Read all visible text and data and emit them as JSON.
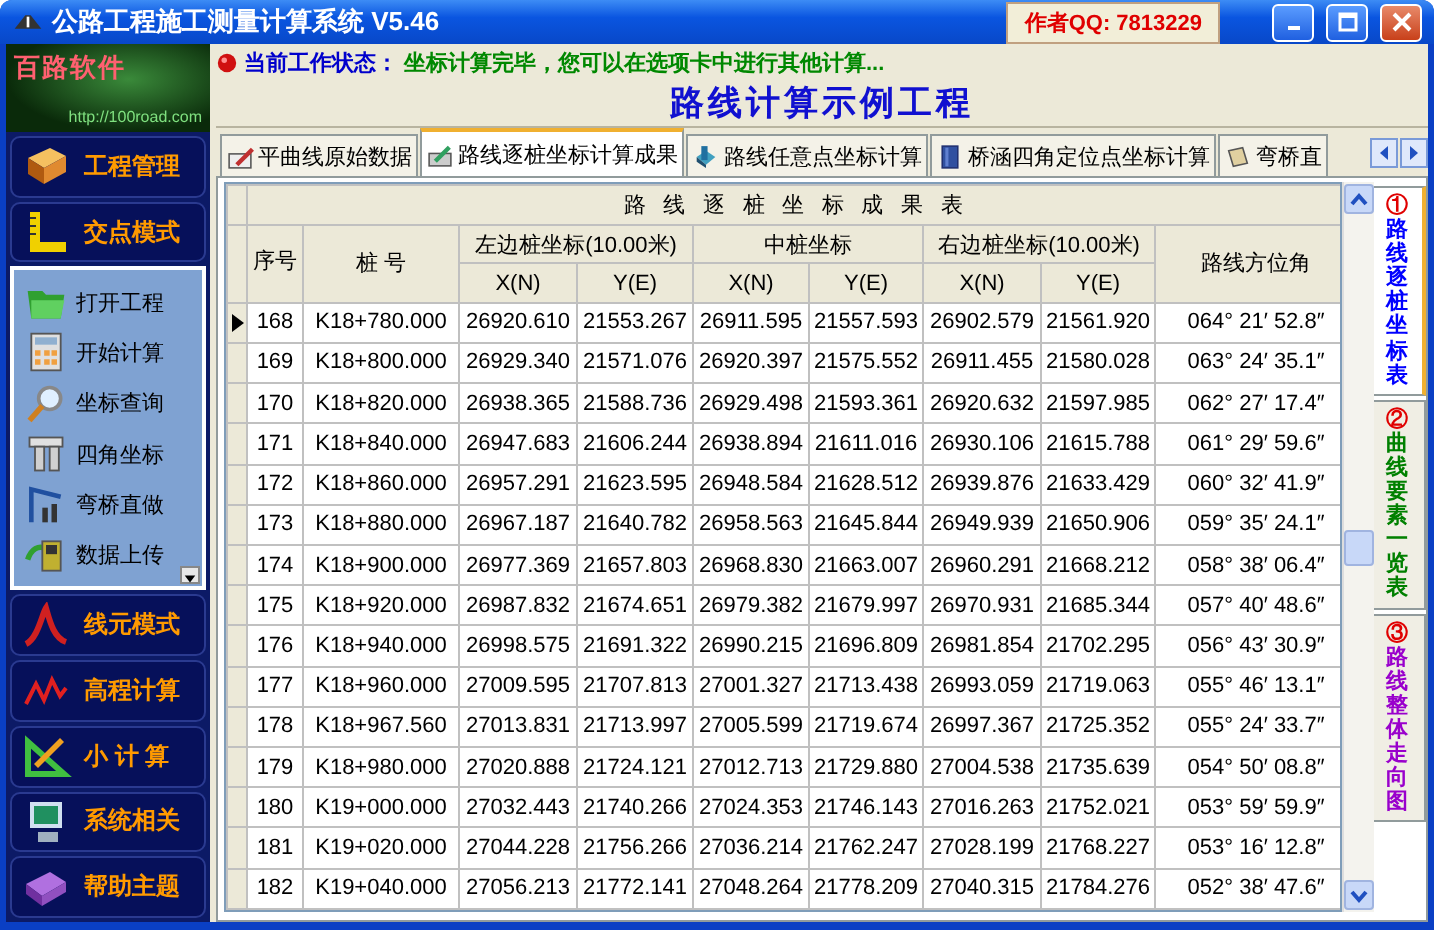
{
  "window": {
    "title": "公路工程施工测量计算系统 V5.46",
    "author_badge": "作者QQ: 7813229"
  },
  "logo": {
    "name": "百路软件",
    "url": "http://100road.com"
  },
  "nav": [
    {
      "label": "工程管理",
      "expanded": false
    },
    {
      "label": "交点模式",
      "expanded": true,
      "children": [
        {
          "label": "打开工程"
        },
        {
          "label": "开始计算"
        },
        {
          "label": "坐标查询"
        },
        {
          "label": "四角坐标"
        },
        {
          "label": "弯桥直做"
        },
        {
          "label": "数据上传"
        }
      ]
    },
    {
      "label": "线元模式",
      "expanded": false
    },
    {
      "label": "高程计算",
      "expanded": false
    },
    {
      "label": "小 计 算",
      "expanded": false
    },
    {
      "label": "系统相关",
      "expanded": false
    },
    {
      "label": "帮助主题",
      "expanded": false
    }
  ],
  "status": {
    "label": "当前工作状态：",
    "text": "坐标计算完毕，您可以在选项卡中进行其他计算..."
  },
  "project_title": "路线计算示例工程",
  "tabs": [
    {
      "label": "平曲线原始数据",
      "selected": false
    },
    {
      "label": "路线逐桩坐标计算成果",
      "selected": true
    },
    {
      "label": "路线任意点坐标计算",
      "selected": false
    },
    {
      "label": "桥涵四角定位点坐标计算",
      "selected": false
    },
    {
      "label": "弯桥直",
      "selected": false
    }
  ],
  "table": {
    "title": "路线逐桩坐标成果表",
    "headers": {
      "no": "序号",
      "station": "桩 号",
      "left": "左边桩坐标(10.00米)",
      "middle": "中桩坐标",
      "right": "右边桩坐标(10.00米)",
      "azimuth": "路线方位角",
      "sub": [
        "X(N)",
        "Y(E)",
        "X(N)",
        "Y(E)",
        "X(N)",
        "Y(E)"
      ]
    },
    "rows": [
      {
        "current": true,
        "cells": [
          "168",
          "K18+780.000",
          "26920.610",
          "21553.267",
          "26911.595",
          "21557.593",
          "26902.579",
          "21561.920",
          "064° 21′ 52.8″"
        ]
      },
      {
        "current": false,
        "cells": [
          "169",
          "K18+800.000",
          "26929.340",
          "21571.076",
          "26920.397",
          "21575.552",
          "26911.455",
          "21580.028",
          "063° 24′ 35.1″"
        ]
      },
      {
        "current": false,
        "cells": [
          "170",
          "K18+820.000",
          "26938.365",
          "21588.736",
          "26929.498",
          "21593.361",
          "26920.632",
          "21597.985",
          "062° 27′ 17.4″"
        ]
      },
      {
        "current": false,
        "cells": [
          "171",
          "K18+840.000",
          "26947.683",
          "21606.244",
          "26938.894",
          "21611.016",
          "26930.106",
          "21615.788",
          "061° 29′ 59.6″"
        ]
      },
      {
        "current": false,
        "cells": [
          "172",
          "K18+860.000",
          "26957.291",
          "21623.595",
          "26948.584",
          "21628.512",
          "26939.876",
          "21633.429",
          "060° 32′ 41.9″"
        ]
      },
      {
        "current": false,
        "cells": [
          "173",
          "K18+880.000",
          "26967.187",
          "21640.782",
          "26958.563",
          "21645.844",
          "26949.939",
          "21650.906",
          "059° 35′ 24.1″"
        ]
      },
      {
        "current": false,
        "cells": [
          "174",
          "K18+900.000",
          "26977.369",
          "21657.803",
          "26968.830",
          "21663.007",
          "26960.291",
          "21668.212",
          "058° 38′ 06.4″"
        ]
      },
      {
        "current": false,
        "cells": [
          "175",
          "K18+920.000",
          "26987.832",
          "21674.651",
          "26979.382",
          "21679.997",
          "26970.931",
          "21685.344",
          "057° 40′ 48.6″"
        ]
      },
      {
        "current": false,
        "cells": [
          "176",
          "K18+940.000",
          "26998.575",
          "21691.322",
          "26990.215",
          "21696.809",
          "26981.854",
          "21702.295",
          "056° 43′ 30.9″"
        ]
      },
      {
        "current": false,
        "cells": [
          "177",
          "K18+960.000",
          "27009.595",
          "21707.813",
          "27001.327",
          "21713.438",
          "26993.059",
          "21719.063",
          "055° 46′ 13.1″"
        ]
      },
      {
        "current": false,
        "cells": [
          "178",
          "K18+967.560",
          "27013.831",
          "21713.997",
          "27005.599",
          "21719.674",
          "26997.367",
          "21725.352",
          "055° 24′ 33.7″"
        ]
      },
      {
        "current": false,
        "cells": [
          "179",
          "K18+980.000",
          "27020.888",
          "21724.121",
          "27012.713",
          "21729.880",
          "27004.538",
          "21735.639",
          "054° 50′ 08.8″"
        ]
      },
      {
        "current": false,
        "cells": [
          "180",
          "K19+000.000",
          "27032.443",
          "21740.266",
          "27024.353",
          "21746.143",
          "27016.263",
          "21752.021",
          "053° 59′ 59.9″"
        ]
      },
      {
        "current": false,
        "cells": [
          "181",
          "K19+020.000",
          "27044.228",
          "21756.266",
          "27036.214",
          "21762.247",
          "27028.199",
          "21768.227",
          "053° 16′ 12.8″"
        ]
      },
      {
        "current": false,
        "cells": [
          "182",
          "K19+040.000",
          "27056.213",
          "21772.141",
          "27048.264",
          "21778.209",
          "27040.315",
          "21784.276",
          "052° 38′ 47.6″"
        ]
      }
    ]
  },
  "side_tabs": [
    {
      "number": "①",
      "label": "路线逐桩坐标表",
      "selected": true,
      "color": "#0000ff"
    },
    {
      "number": "②",
      "label": "曲线要素一览表",
      "selected": false,
      "color": "#008000"
    },
    {
      "number": "③",
      "label": "路线整体走向图",
      "selected": false,
      "color": "#9900cc"
    }
  ]
}
